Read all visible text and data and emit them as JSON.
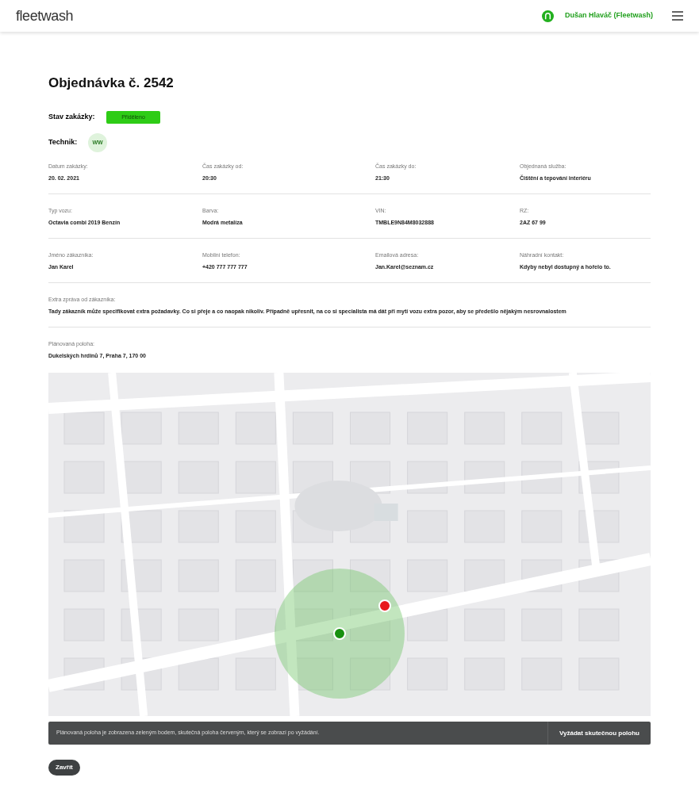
{
  "header": {
    "logo": "fleetwash",
    "user": "Dušan Hlaváč (Fleetwash)"
  },
  "title": "Objednávka č. 2542",
  "status": {
    "label": "Stav zakázky:",
    "value": "Přiděleno"
  },
  "technician": {
    "label": "Technik:",
    "initials": "WW"
  },
  "info_rows": [
    [
      {
        "label": "Datum zakázky:",
        "value": "20. 02. 2021"
      },
      {
        "label": "Čas zakázky od:",
        "value": "20:30"
      },
      {
        "label": "Čas zakázky do:",
        "value": "21:30"
      },
      {
        "label": "Objednaná služba:",
        "value": "Čištění a tepování interiéru"
      }
    ],
    [
      {
        "label": "Typ vozu:",
        "value": "Octavia combi 2019 Benzín"
      },
      {
        "label": "Barva:",
        "value": "Modrá metalíza"
      },
      {
        "label": "VIN:",
        "value": "TMBLE9N84M8032888"
      },
      {
        "label": "RZ:",
        "value": "2AZ 67 99"
      }
    ],
    [
      {
        "label": "Jméno zákazníka:",
        "value": "Jan Karel"
      },
      {
        "label": "Mobilní telefon:",
        "value": "+420 777 777 777"
      },
      {
        "label": "Emailová adresa:",
        "value": "Jan.Karel@seznam.cz"
      },
      {
        "label": "Náhradní kontakt:",
        "value": "Kdyby nebyl dostupný a hořelo to."
      }
    ]
  ],
  "message": {
    "label": "Extra zpráva od zákazníka:",
    "value": "Tady zákazník může specifikovat extra požadavky. Co si přeje a co naopak nikoliv. Případně upřesnit, na co si specialista má dát při mytí vozu extra pozor, aby se předešlo nějakým nesrovnalostem"
  },
  "location": {
    "label": "Plánovaná poloha:",
    "value": "Dukelských hrdinů 7, Praha 7, 170 00"
  },
  "map_notice": {
    "text": "Plánovaná poloha je zobrazena zeleným bodem, skutečná poloha červeným, který se zobrazí po vyžádání.",
    "button": "Vyžádat skutečnou polohu"
  },
  "close_button": "Zavřít"
}
